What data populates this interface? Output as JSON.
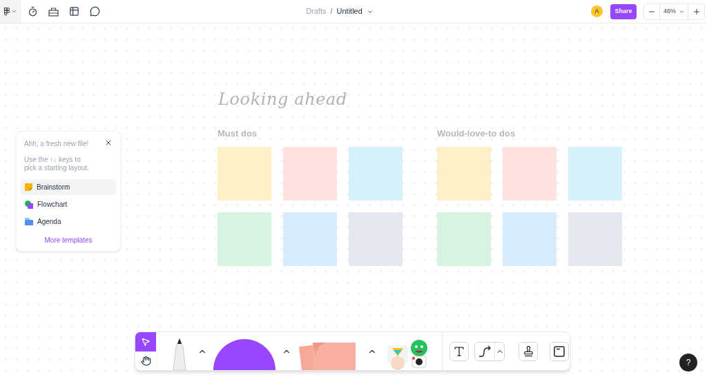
{
  "topbar": {
    "breadcrumb": [
      "Drafts",
      "Untitled"
    ],
    "separator": "/",
    "avatar": "A",
    "share": "Share",
    "zoom": "46%"
  },
  "canvas": {
    "title": "Looking ahead",
    "sections": [
      {
        "heading": "Must dos",
        "stickies": [
          {
            "color": "#fdf0c6"
          },
          {
            "color": "#fde2dd"
          },
          {
            "color": "#d7f1fa"
          },
          {
            "color": "#d8f3df"
          },
          {
            "color": "#d6ebfc"
          },
          {
            "color": "#e5e7ef"
          }
        ]
      },
      {
        "heading": "Would-love-to dos",
        "stickies": [
          {
            "color": "#fdf0c6"
          },
          {
            "color": "#fde2dd"
          },
          {
            "color": "#d7f1fa"
          },
          {
            "color": "#d8f3df"
          },
          {
            "color": "#d6ebfc"
          },
          {
            "color": "#e5e7ef"
          }
        ]
      }
    ]
  },
  "panel": {
    "title": "Ahh, a fresh new file!",
    "hint": "Use the ↑↓ keys to pick a starting layout.",
    "items": [
      {
        "label": "Brainstorm",
        "selected": true,
        "kind": "brainstorm"
      },
      {
        "label": "Flowchart",
        "selected": false,
        "kind": "flowchart"
      },
      {
        "label": "Agenda",
        "selected": false,
        "kind": "agenda"
      }
    ],
    "link": "More templates"
  },
  "toolbar": {
    "tools": [
      {
        "kind": "select",
        "selected": true
      },
      {
        "kind": "hand",
        "selected": false
      }
    ]
  },
  "help": "?"
}
